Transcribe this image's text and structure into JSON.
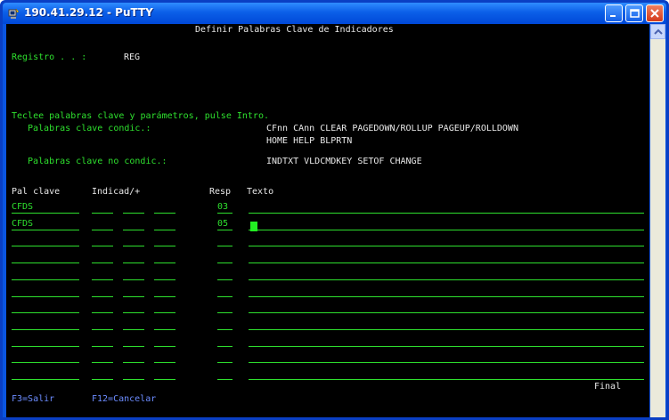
{
  "window": {
    "title": "190.41.29.12 - PuTTY"
  },
  "screen": {
    "heading": "Definir Palabras Clave de Indicadores",
    "registro_label": "Registro . . :",
    "registro_value": "REG",
    "instructions": "Teclee palabras clave y parámetros, pulse Intro.",
    "cond_label": "Palabras clave condic.:",
    "cond_line1": "CFnn CAnn CLEAR PAGEDOWN/ROLLUP PAGEUP/ROLLDOWN",
    "cond_line2": "HOME HELP BLPRTN",
    "nocond_label": "Palabras clave no condic.:",
    "nocond_line": "INDTXT VLDCMDKEY SETOF CHANGE",
    "columns": {
      "keyword": "Pal clave",
      "indicators": "Indicad/+",
      "resp": "Resp",
      "text": "Texto"
    },
    "rows": [
      {
        "keyword": "CFDS",
        "resp": "03"
      },
      {
        "keyword": "CFDS",
        "resp": "05"
      },
      {
        "keyword": "",
        "resp": ""
      },
      {
        "keyword": "",
        "resp": ""
      },
      {
        "keyword": "",
        "resp": ""
      },
      {
        "keyword": "",
        "resp": ""
      },
      {
        "keyword": "",
        "resp": ""
      },
      {
        "keyword": "",
        "resp": ""
      },
      {
        "keyword": "",
        "resp": ""
      },
      {
        "keyword": "",
        "resp": ""
      },
      {
        "keyword": "",
        "resp": ""
      }
    ],
    "status": "Final",
    "fkeys": [
      {
        "label": "F3=Salir"
      },
      {
        "label": "F12=Cancelar"
      }
    ]
  },
  "colors": {
    "terminal_bg": "#000000",
    "text_white": "#e8e8e8",
    "field_green": "#2ee02e",
    "fkey_blue": "#6c8cff",
    "titlebar_blue": "#0b5fe8"
  },
  "icons": [
    "putty-app-icon",
    "minimize-icon",
    "maximize-icon",
    "close-icon",
    "scroll-up-arrow-icon"
  ]
}
